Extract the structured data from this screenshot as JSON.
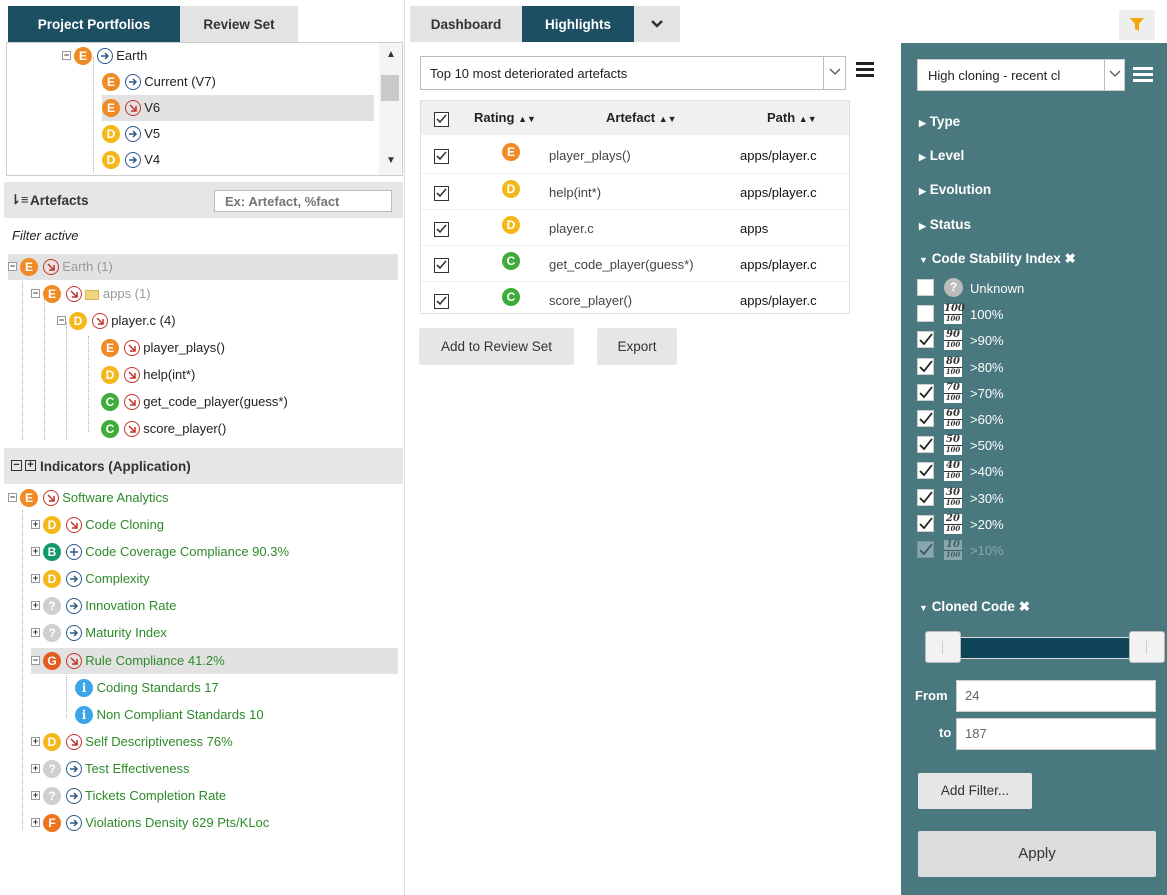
{
  "tabs_left": [
    "Project Portfolios",
    "Review Set"
  ],
  "tabs_mid": [
    "Dashboard",
    "Highlights"
  ],
  "portfolio_tree": [
    {
      "badge": "E",
      "arrow": "blue",
      "label": "Earth"
    },
    {
      "badge": "E",
      "arrow": "blue",
      "label": "Current (V7)"
    },
    {
      "badge": "E",
      "arrow": "red",
      "label": "V6"
    },
    {
      "badge": "D",
      "arrow": "blue",
      "label": "V5"
    },
    {
      "badge": "D",
      "arrow": "blue",
      "label": "V4"
    }
  ],
  "artefacts": {
    "title": "Artefacts",
    "search_placeholder": "Ex: Artefact, %fact",
    "filter_label": "Filter active",
    "tree": [
      {
        "badge": "E",
        "label": "Earth (1)"
      },
      {
        "badge": "E",
        "label": "apps (1)"
      },
      {
        "badge": "D",
        "label": "player.c (4)"
      },
      {
        "badge": "E",
        "label": "player_plays()"
      },
      {
        "badge": "D",
        "label": "help(int*)"
      },
      {
        "badge": "C",
        "label": "get_code_player(guess*)"
      },
      {
        "badge": "C",
        "label": "score_player()"
      }
    ]
  },
  "indicators": {
    "title": "Indicators (Application)",
    "items": [
      {
        "badge": "E",
        "arrow": "red",
        "label": "Software Analytics"
      },
      {
        "badge": "D",
        "arrow": "red",
        "label": "Code Cloning"
      },
      {
        "badge": "B",
        "arrow": "plus",
        "label": "Code Coverage Compliance 90.3%"
      },
      {
        "badge": "D",
        "arrow": "blue",
        "label": "Complexity"
      },
      {
        "badge": "?",
        "arrow": "blue",
        "label": "Innovation Rate"
      },
      {
        "badge": "?",
        "arrow": "blue",
        "label": "Maturity Index"
      },
      {
        "badge": "G",
        "arrow": "red",
        "label": "Rule Compliance 41.2%"
      },
      {
        "badge": "i",
        "arrow": "",
        "label": "Coding Standards 17"
      },
      {
        "badge": "i",
        "arrow": "",
        "label": "Non Compliant Standards 10"
      },
      {
        "badge": "D",
        "arrow": "red",
        "label": "Self Descriptiveness 76%"
      },
      {
        "badge": "?",
        "arrow": "blue",
        "label": "Test Effectiveness"
      },
      {
        "badge": "?",
        "arrow": "blue",
        "label": "Tickets Completion Rate"
      },
      {
        "badge": "F",
        "arrow": "blue",
        "label": "Violations Density 629 Pts/KLoc"
      }
    ]
  },
  "highlights": {
    "selected": "Top 10 most deteriorated artefacts",
    "columns": [
      "Rating",
      "Artefact",
      "Path"
    ],
    "rows": [
      {
        "rating": "E",
        "artefact": "player_plays()",
        "path": "apps/player.c"
      },
      {
        "rating": "D",
        "artefact": "help(int*)",
        "path": "apps/player.c"
      },
      {
        "rating": "D",
        "artefact": "player.c",
        "path": "apps"
      },
      {
        "rating": "C",
        "artefact": "get_code_player(guess*)",
        "path": "apps/player.c"
      },
      {
        "rating": "C",
        "artefact": "score_player()",
        "path": "apps/player.c"
      }
    ],
    "add_review": "Add to Review Set",
    "export": "Export"
  },
  "filters": {
    "selected": "High cloning - recent cl",
    "sections": [
      "Type",
      "Level",
      "Evolution",
      "Status"
    ],
    "csi_title": "Code Stability Index",
    "csi_items": [
      {
        "label": "Unknown",
        "checked": false,
        "num": "?"
      },
      {
        "label": "100%",
        "checked": false,
        "num": "100"
      },
      {
        "label": ">90%",
        "checked": true,
        "num": "90"
      },
      {
        "label": ">80%",
        "checked": true,
        "num": "80"
      },
      {
        "label": ">70%",
        "checked": true,
        "num": "70"
      },
      {
        "label": ">60%",
        "checked": true,
        "num": "60"
      },
      {
        "label": ">50%",
        "checked": true,
        "num": "50"
      },
      {
        "label": ">40%",
        "checked": true,
        "num": "40"
      },
      {
        "label": ">30%",
        "checked": true,
        "num": "30"
      },
      {
        "label": ">20%",
        "checked": true,
        "num": "20"
      },
      {
        "label": ">10%",
        "checked": true,
        "num": "10"
      }
    ],
    "cloned_title": "Cloned Code",
    "from_label": "From",
    "from_value": "24",
    "to_label": "to",
    "to_value": "187",
    "add_filter": "Add Filter...",
    "apply": "Apply"
  },
  "colors": {
    "accent": "#1d4f63",
    "panel": "#49787f",
    "filter_icon": "#f5a70a"
  }
}
